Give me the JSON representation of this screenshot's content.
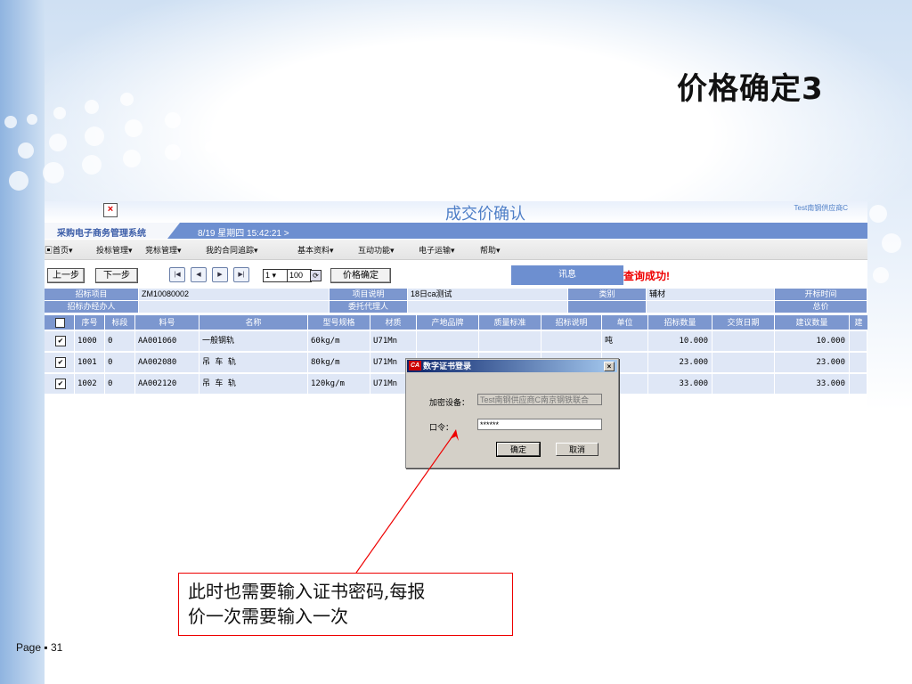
{
  "slide": {
    "title": "价格确定3",
    "footer": "Page ▪ 31"
  },
  "app": {
    "title": "成交价确认",
    "user": "Test南钢供应商C",
    "system_name": "采购电子商务管理系统",
    "datetime": "8/19 星期四  15:42:21 >",
    "menu": [
      {
        "label": "首页▾"
      },
      {
        "label": "投标管理▾"
      },
      {
        "label": "竞标管理▾"
      },
      {
        "label": "我的合同追踪▾"
      },
      {
        "label": "基本资料▾"
      },
      {
        "label": "互动功能▾"
      },
      {
        "label": "电子运输▾"
      },
      {
        "label": "帮助▾"
      }
    ],
    "toolbar": {
      "prev": "上一步",
      "next": "下一步",
      "page": "1 ▾",
      "page_total": "100",
      "confirm": "价格确定",
      "msg_label": "讯息",
      "msg_text": "查询成功!"
    },
    "info": {
      "project_label": "招标项目",
      "project_value": "ZM10080002",
      "desc_label": "项目说明",
      "desc_value": "18日ca测试",
      "category_label": "类别",
      "category_value": "辅材",
      "open_time_label": "开标时间",
      "handler_label": "招标办经办人",
      "agent_label": "委托代理人",
      "total_label": "总价"
    },
    "grid": {
      "headers": [
        "序号",
        "标段",
        "料号",
        "名称",
        "型号规格",
        "材质",
        "产地品牌",
        "质量标准",
        "招标说明",
        "单位",
        "招标数量",
        "交货日期",
        "建议数量",
        "建"
      ],
      "rows": [
        {
          "checked": "✔",
          "seq": "1000",
          "lot": "0",
          "part": "AA001060",
          "name": "一般钢轨",
          "spec": "60kg/m",
          "material": "U71Mn",
          "unit": "吨",
          "qty": "10.000",
          "suggest": "10.000"
        },
        {
          "checked": "✔",
          "seq": "1001",
          "lot": "0",
          "part": "AA002080",
          "name": "吊 车 轨",
          "spec": "80kg/m",
          "material": "U71Mn",
          "unit": "",
          "qty": "23.000",
          "suggest": "23.000"
        },
        {
          "checked": "✔",
          "seq": "1002",
          "lot": "0",
          "part": "AA002120",
          "name": "吊 车 轨",
          "spec": "120kg/m",
          "material": "U71Mn",
          "unit": "",
          "qty": "33.000",
          "suggest": "33.000"
        }
      ]
    },
    "dialog": {
      "logo": "CA",
      "title": "数字证书登录",
      "device_label": "加密设备：",
      "device_value": "Test南钢供应商C南京钢铁联合",
      "password_label": "口令：",
      "password_value": "******",
      "ok": "确定",
      "cancel": "取消"
    }
  },
  "callout": {
    "line1": "此时也需要输入证书密码,每报",
    "line2": "价一次需要输入一次"
  },
  "colors": {
    "header_blue": "#7c97cf",
    "row_blue": "#dfe7f6",
    "accent_red": "#e00000",
    "title_blue": "#4f7fc7"
  }
}
